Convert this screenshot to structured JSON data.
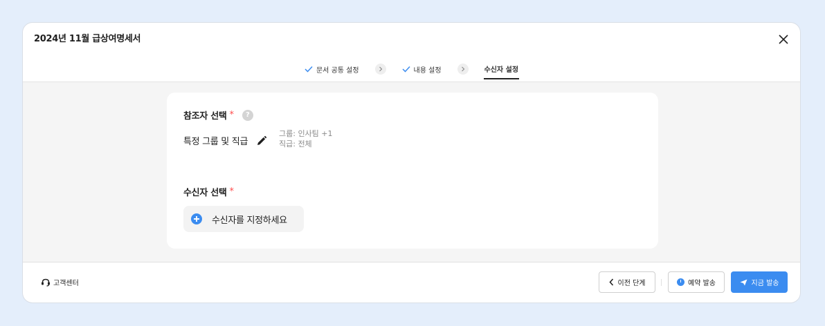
{
  "window": {
    "title": "2024년 11월 급상여명세서"
  },
  "steps": [
    {
      "label": "문서 공통 설정",
      "done": true
    },
    {
      "label": "내용 설정",
      "done": true
    },
    {
      "label": "수신자 설정",
      "active": true
    }
  ],
  "reference": {
    "title": "참조자 선택",
    "required_mark": "*",
    "help_glyph": "?",
    "selection_label": "특정 그룹 및 직급",
    "group_text": "그룹: 인사팀 +1",
    "position_text": "직급: 전체"
  },
  "recipients": {
    "title": "수신자 선택",
    "required_mark": "*",
    "add_label": "수신자를 지정하세요"
  },
  "footer": {
    "support_label": "고객센터",
    "prev_label": "이전 단계",
    "schedule_label": "예약 발송",
    "send_now_label": "지금 발송"
  },
  "colors": {
    "accent": "#3b8cf0",
    "required": "#ff4b4b",
    "panel_bg": "#f5f5f5",
    "page_bg": "#e4eefb"
  },
  "icons": [
    "close-icon",
    "check-icon",
    "chevron-right-icon",
    "help-icon",
    "pencil-icon",
    "plus-circle-icon",
    "headset-icon",
    "chevron-left-icon",
    "clock-icon",
    "send-icon"
  ]
}
